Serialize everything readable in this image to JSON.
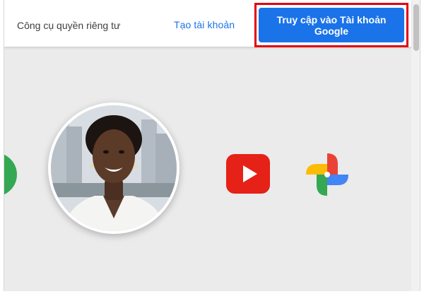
{
  "header": {
    "privacy_link": "Công cụ quyền riêng tư",
    "create_account": "Tạo tài khoản",
    "cta": "Truy cập vào Tài khoản Google"
  },
  "colors": {
    "accent": "#1a73e8",
    "highlight": "#e3000f",
    "background": "#ebebeb"
  },
  "icons": [
    "youtube-icon",
    "google-photos-icon"
  ]
}
